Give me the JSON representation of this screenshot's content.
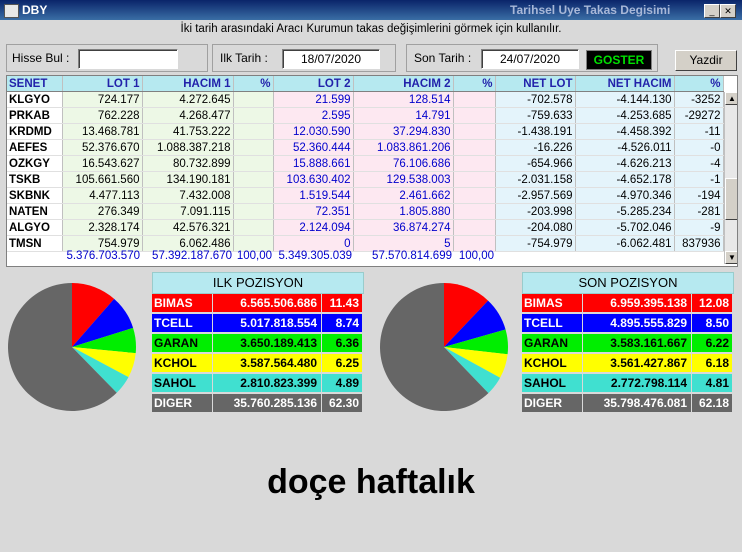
{
  "window": {
    "title": "DBY",
    "caption": "Tarihsel Uye Takas Degisimi"
  },
  "subtitle": "İki tarih arasındaki  Aracı Kurumun takas değişimlerini görmek için kullanılır.",
  "controls": {
    "hisse_label": "Hisse Bul :",
    "hisse_value": "",
    "ilk_label": "Ilk Tarih :",
    "ilk_value": "18/07/2020",
    "son_label": "Son Tarih :",
    "son_value": "24/07/2020",
    "goster_label": "GOSTER",
    "yazdir_label": "Yazdir"
  },
  "table": {
    "headers": [
      "SENET",
      "LOT 1",
      "HACIM 1",
      "%",
      "LOT 2",
      "HACIM 2",
      "%",
      "NET LOT",
      "NET HACIM",
      "%"
    ],
    "rows": [
      [
        "KLGYO",
        "724.177",
        "4.272.645",
        "",
        "21.599",
        "128.514",
        "",
        "-702.578",
        "-4.144.130",
        "-3252"
      ],
      [
        "PRKAB",
        "762.228",
        "4.268.477",
        "",
        "2.595",
        "14.791",
        "",
        "-759.633",
        "-4.253.685",
        "-29272"
      ],
      [
        "KRDMD",
        "13.468.781",
        "41.753.222",
        "",
        "12.030.590",
        "37.294.830",
        "",
        "-1.438.191",
        "-4.458.392",
        "-11"
      ],
      [
        "AEFES",
        "52.376.670",
        "1.088.387.218",
        "",
        "52.360.444",
        "1.083.861.206",
        "",
        "-16.226",
        "-4.526.011",
        "-0"
      ],
      [
        "OZKGY",
        "16.543.627",
        "80.732.899",
        "",
        "15.888.661",
        "76.106.686",
        "",
        "-654.966",
        "-4.626.213",
        "-4"
      ],
      [
        "TSKB",
        "105.661.560",
        "134.190.181",
        "",
        "103.630.402",
        "129.538.003",
        "",
        "-2.031.158",
        "-4.652.178",
        "-1"
      ],
      [
        "SKBNK",
        "4.477.113",
        "7.432.008",
        "",
        "1.519.544",
        "2.461.662",
        "",
        "-2.957.569",
        "-4.970.346",
        "-194"
      ],
      [
        "NATEN",
        "276.349",
        "7.091.115",
        "",
        "72.351",
        "1.805.880",
        "",
        "-203.998",
        "-5.285.234",
        "-281"
      ],
      [
        "ALGYO",
        "2.328.174",
        "42.576.321",
        "",
        "2.124.094",
        "36.874.274",
        "",
        "-204.080",
        "-5.702.046",
        "-9"
      ],
      [
        "TMSN",
        "754.979",
        "6.062.486",
        "",
        "0",
        "5",
        "",
        "-754.979",
        "-6.062.481",
        "837936"
      ]
    ],
    "totals": {
      "lot1": "5.376.703.570",
      "hacim1": "57.392.187.670",
      "pct1": "100,00",
      "lot2": "5.349.305.039",
      "hacim2": "57.570.814.699",
      "pct2": "100,00"
    }
  },
  "ilk_pozisyon": {
    "title": "ILK POZISYON",
    "rows": [
      {
        "name": "BIMAS",
        "value": "6.565.506.686",
        "pct": "11.43",
        "pct_num": 11.43,
        "bg": "#ff0000",
        "fg": "#ffffff"
      },
      {
        "name": "TCELL",
        "value": "5.017.818.554",
        "pct": "8.74",
        "pct_num": 8.74,
        "bg": "#0000ff",
        "fg": "#ffffff"
      },
      {
        "name": "GARAN",
        "value": "3.650.189.413",
        "pct": "6.36",
        "pct_num": 6.36,
        "bg": "#00ee00",
        "fg": "#000000"
      },
      {
        "name": "KCHOL",
        "value": "3.587.564.480",
        "pct": "6.25",
        "pct_num": 6.25,
        "bg": "#ffff00",
        "fg": "#000000"
      },
      {
        "name": "SAHOL",
        "value": "2.810.823.399",
        "pct": "4.89",
        "pct_num": 4.89,
        "bg": "#40e0d0",
        "fg": "#000000"
      },
      {
        "name": "DIGER",
        "value": "35.760.285.136",
        "pct": "62.30",
        "pct_num": 62.3,
        "bg": "#666666",
        "fg": "#ffffff"
      }
    ]
  },
  "son_pozisyon": {
    "title": "SON POZISYON",
    "rows": [
      {
        "name": "BIMAS",
        "value": "6.959.395.138",
        "pct": "12.08",
        "pct_num": 12.08,
        "bg": "#ff0000",
        "fg": "#ffffff"
      },
      {
        "name": "TCELL",
        "value": "4.895.555.829",
        "pct": "8.50",
        "pct_num": 8.5,
        "bg": "#0000ff",
        "fg": "#ffffff"
      },
      {
        "name": "GARAN",
        "value": "3.583.161.667",
        "pct": "6.22",
        "pct_num": 6.22,
        "bg": "#00ee00",
        "fg": "#000000"
      },
      {
        "name": "KCHOL",
        "value": "3.561.427.867",
        "pct": "6.18",
        "pct_num": 6.18,
        "bg": "#ffff00",
        "fg": "#000000"
      },
      {
        "name": "SAHOL",
        "value": "2.772.798.114",
        "pct": "4.81",
        "pct_num": 4.81,
        "bg": "#40e0d0",
        "fg": "#000000"
      },
      {
        "name": "DIGER",
        "value": "35.798.476.081",
        "pct": "62.18",
        "pct_num": 62.18,
        "bg": "#666666",
        "fg": "#ffffff"
      }
    ]
  },
  "caption": "doçe haftalık"
}
